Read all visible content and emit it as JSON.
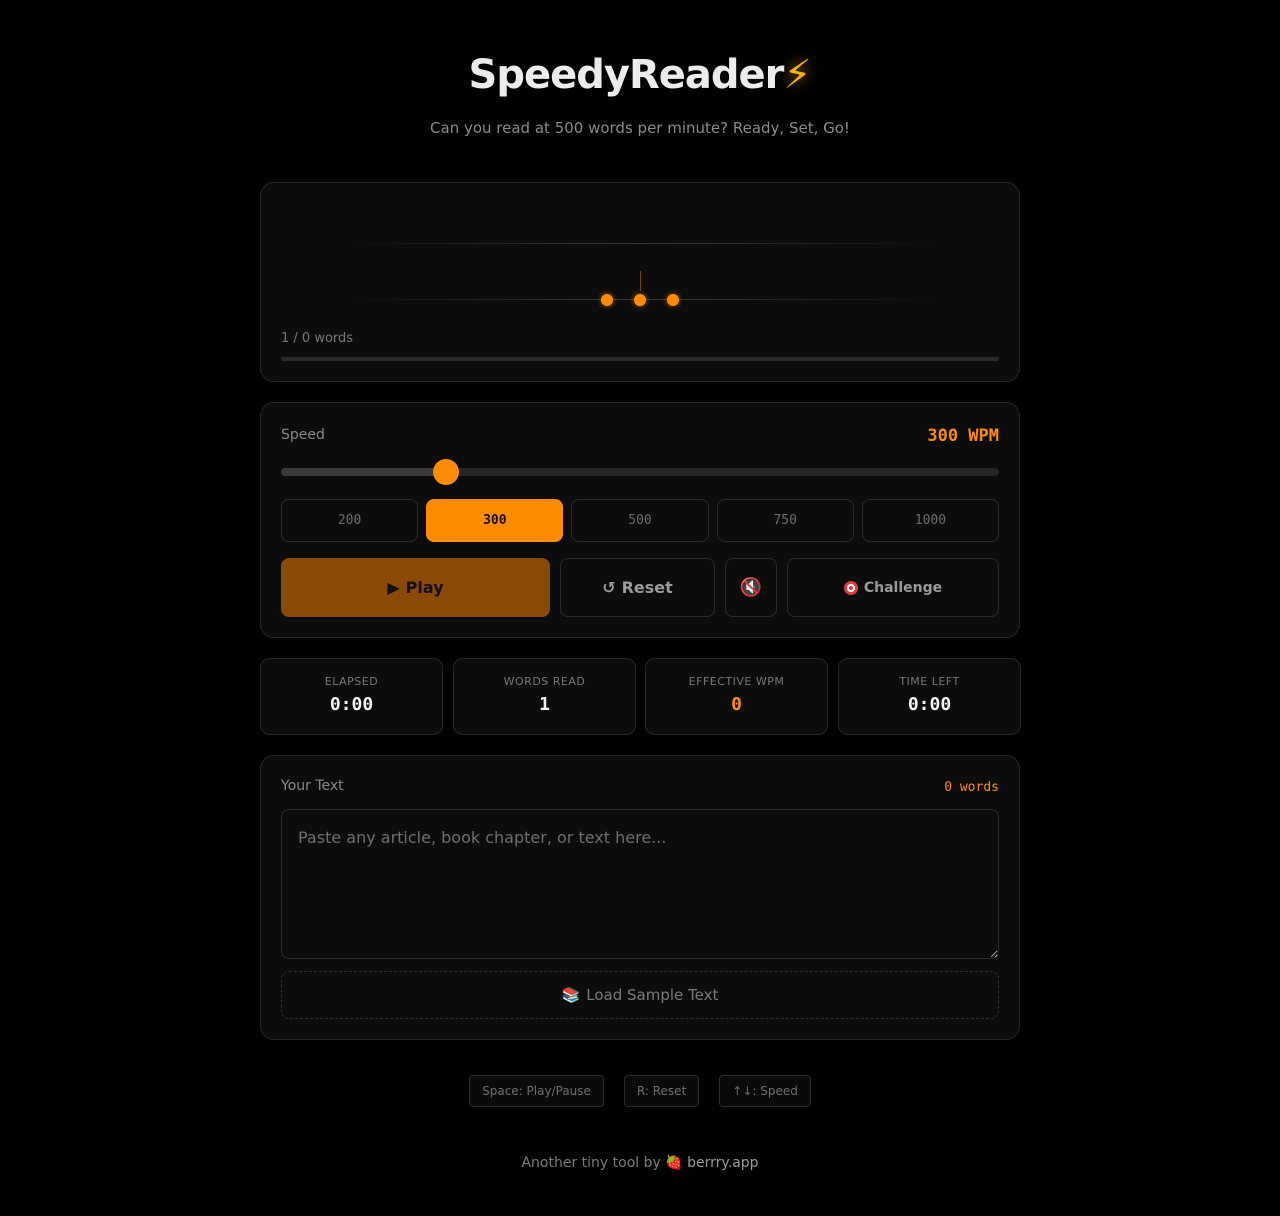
{
  "header": {
    "title": "SpeedyReader",
    "title_emoji": "⚡",
    "subtitle": "Can you read at 500 words per minute? Ready, Set, Go!"
  },
  "reader": {
    "progress_text": "1 / 0 words",
    "progress_fraction": 0
  },
  "speed": {
    "label": "Speed",
    "value_text": "300 WPM",
    "current_wpm": 300,
    "slider_fraction": 0.23,
    "presets": [
      "200",
      "300",
      "500",
      "750",
      "1000"
    ],
    "active_preset": "300"
  },
  "controls": {
    "play_label": "Play",
    "play_glyph": "▶",
    "reset_label": "Reset",
    "reset_glyph": "↺",
    "mute_glyph": "🔇",
    "challenge_label": "Challenge",
    "challenge_icon": "target-icon"
  },
  "stats": [
    {
      "label": "ELAPSED",
      "value": "0:00",
      "accent": false
    },
    {
      "label": "WORDS READ",
      "value": "1",
      "accent": false
    },
    {
      "label": "EFFECTIVE WPM",
      "value": "0",
      "accent": true
    },
    {
      "label": "TIME LEFT",
      "value": "0:00",
      "accent": false
    }
  ],
  "text_input": {
    "label": "Your Text",
    "word_count": "0 words",
    "placeholder": "Paste any article, book chapter, or text here...",
    "value": "",
    "sample_label": "Load Sample Text",
    "sample_glyph": "📚"
  },
  "shortcuts": [
    "Space: Play/Pause",
    "R: Reset",
    "↑↓: Speed"
  ],
  "footer": {
    "prefix": "Another tiny tool by",
    "brand_glyph": "🍓",
    "brand": "berrry.app"
  },
  "colors": {
    "accent": "#ff8c00",
    "play_button": "#8a4a06",
    "background": "#000000",
    "card": "#0c0c0c"
  }
}
